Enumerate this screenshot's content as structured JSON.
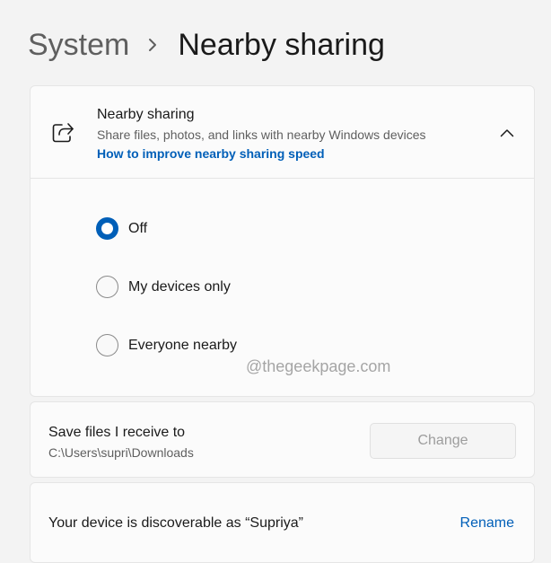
{
  "breadcrumb": {
    "parent": "System",
    "current": "Nearby sharing"
  },
  "nearby_card": {
    "title": "Nearby sharing",
    "description": "Share files, photos, and links with nearby Windows devices",
    "link": "How to improve nearby sharing speed",
    "expanded": true,
    "icon": "share-icon",
    "options": [
      {
        "label": "Off",
        "selected": true
      },
      {
        "label": "My devices only",
        "selected": false
      },
      {
        "label": "Everyone nearby",
        "selected": false
      }
    ]
  },
  "watermark": "@thegeekpage.com",
  "save_card": {
    "title": "Save files I receive to",
    "path": "C:\\Users\\supri\\Downloads",
    "button": "Change",
    "button_enabled": false
  },
  "device_card": {
    "text": "Your device is discoverable as “Supriya”",
    "link": "Rename"
  },
  "colors": {
    "accent": "#005fb8",
    "background": "#f3f3f3",
    "card": "#fbfbfb"
  }
}
